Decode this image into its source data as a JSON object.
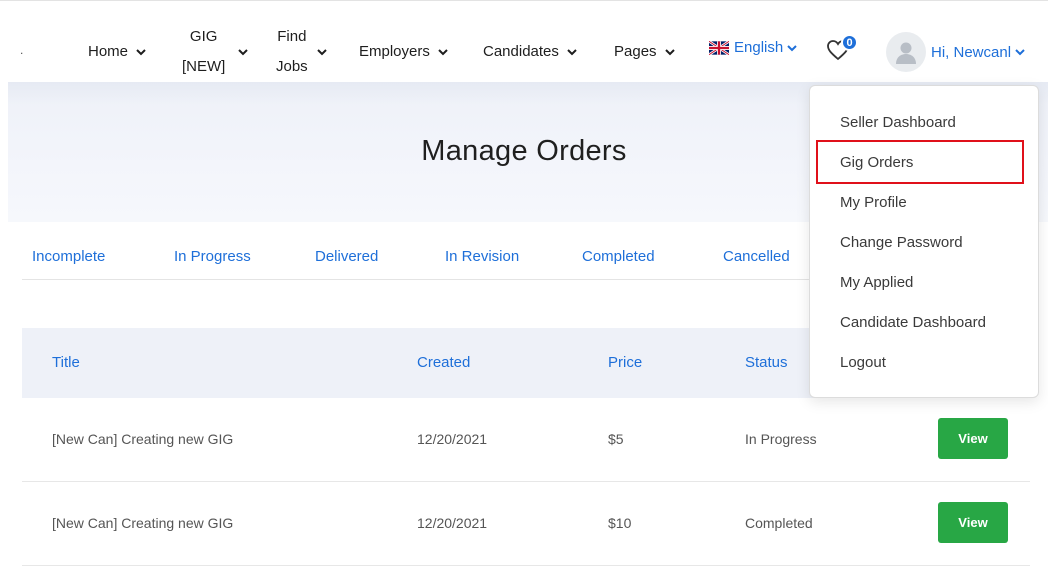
{
  "nav": {
    "logo_mark": ".",
    "home": "Home",
    "gig_line1": "GIG",
    "gig_line2": "[NEW]",
    "findjobs_line1": "Find",
    "findjobs_line2": "Jobs",
    "employers": "Employers",
    "candidates": "Candidates",
    "pages": "Pages",
    "language": "English",
    "wishlist_count": "0",
    "user_greeting": "Hi, Newcanl",
    "icons": [
      "chevron-down-icon",
      "uk-flag-icon",
      "heart-icon",
      "user-avatar-icon"
    ]
  },
  "hero": {
    "title": "Manage Orders"
  },
  "tabs": [
    "Incomplete",
    "In Progress",
    "Delivered",
    "In Revision",
    "Completed",
    "Cancelled"
  ],
  "table": {
    "headers": {
      "title": "Title",
      "created": "Created",
      "price": "Price",
      "status": "Status"
    },
    "rows": [
      {
        "title": "[New Can] Creating new GIG",
        "created": "12/20/2021",
        "price": "$5",
        "status": "In Progress",
        "action": "View"
      },
      {
        "title": "[New Can] Creating new GIG",
        "created": "12/20/2021",
        "price": "$10",
        "status": "Completed",
        "action": "View"
      }
    ]
  },
  "user_menu": {
    "items": [
      "Seller Dashboard",
      "Gig Orders",
      "My Profile",
      "Change Password",
      "My Applied",
      "Candidate Dashboard",
      "Logout"
    ],
    "highlighted": "Gig Orders"
  },
  "colors": {
    "accent": "#1e6fd9",
    "button_green": "#28a745",
    "highlight_red": "#e0101a",
    "hero_bg": "#eef1f8"
  }
}
